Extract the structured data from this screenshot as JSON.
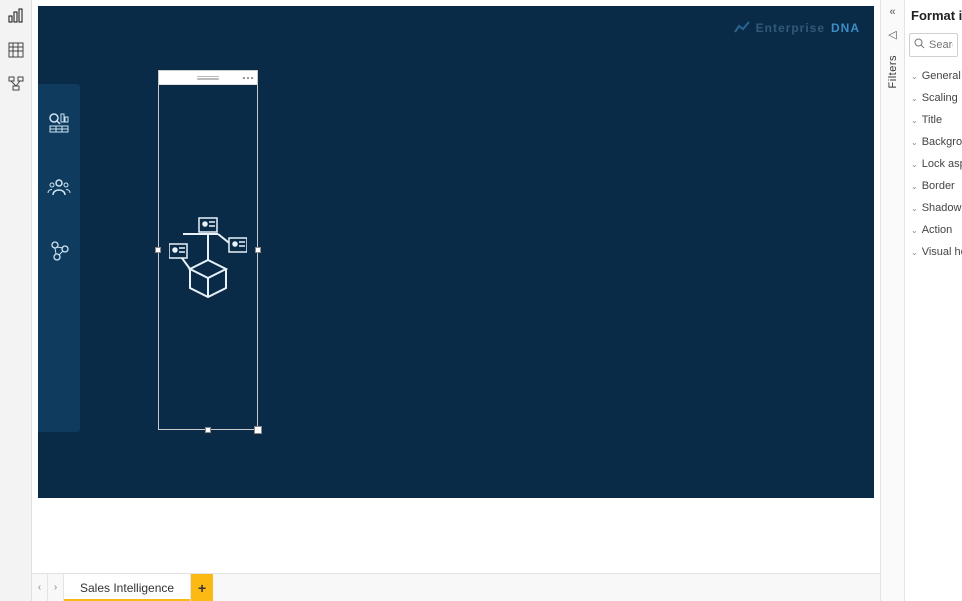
{
  "left_rail": {
    "items": [
      {
        "name": "report-view-icon"
      },
      {
        "name": "data-view-icon"
      },
      {
        "name": "model-view-icon"
      }
    ]
  },
  "canvas": {
    "brand_label": "Enterprise ",
    "brand_accent": "DNA"
  },
  "nav_pod": {
    "icons": [
      {
        "name": "overview-dashboard-icon"
      },
      {
        "name": "customers-icon"
      },
      {
        "name": "products-icon"
      }
    ]
  },
  "selected_visual": {
    "type": "image"
  },
  "page_tabs": {
    "prev_symbol": "‹",
    "next_symbol": "›",
    "tabs": [
      {
        "label": "Sales Intelligence"
      }
    ],
    "add_symbol": "+"
  },
  "filters_rail": {
    "collapse_symbol": "«",
    "pane2_symbol": "◁",
    "label": "Filters"
  },
  "format_pane": {
    "title": "Format im",
    "search_placeholder": "Search",
    "sections": [
      {
        "label": "General"
      },
      {
        "label": "Scaling"
      },
      {
        "label": "Title"
      },
      {
        "label": "Backgro..."
      },
      {
        "label": "Lock asp..."
      },
      {
        "label": "Border"
      },
      {
        "label": "Shadow"
      },
      {
        "label": "Action"
      },
      {
        "label": "Visual he..."
      }
    ]
  }
}
